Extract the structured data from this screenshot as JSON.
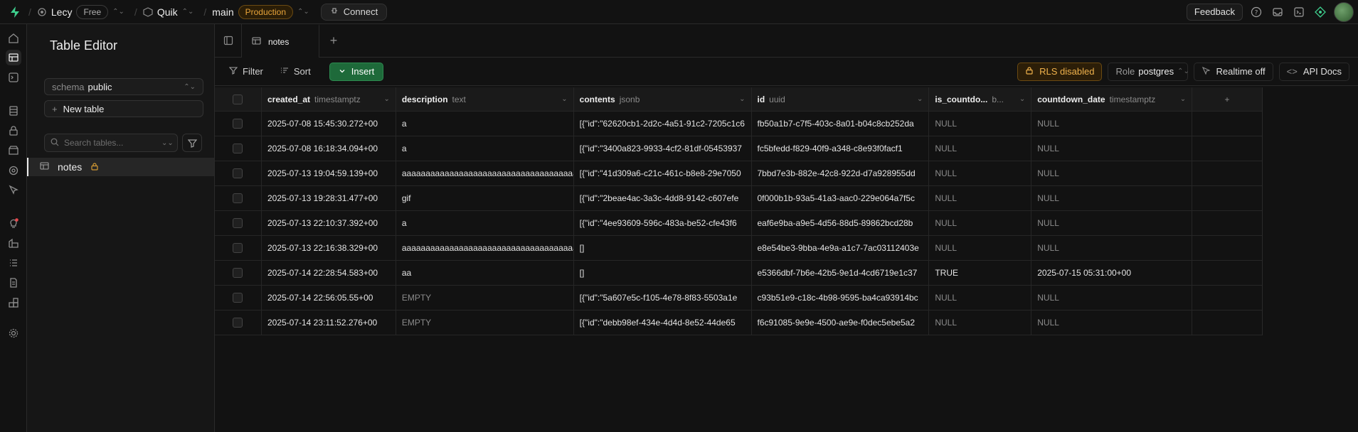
{
  "topbar": {
    "org": "Lecy",
    "plan": "Free",
    "project": "Quik",
    "branch": "main",
    "env": "Production",
    "connect": "Connect",
    "feedback": "Feedback"
  },
  "sidebar": {
    "title": "Table Editor",
    "schema_label": "schema",
    "schema_value": "public",
    "new_table": "New table",
    "search_placeholder": "Search tables...",
    "tables": [
      {
        "name": "notes"
      }
    ]
  },
  "tabs": [
    {
      "label": "notes"
    }
  ],
  "toolbar": {
    "filter": "Filter",
    "sort": "Sort",
    "insert": "Insert",
    "rls": "RLS disabled",
    "role_label": "Role",
    "role_value": "postgres",
    "realtime": "Realtime off",
    "api_docs": "API Docs"
  },
  "columns": [
    {
      "name": "created_at",
      "type": "timestamptz"
    },
    {
      "name": "description",
      "type": "text"
    },
    {
      "name": "contents",
      "type": "jsonb"
    },
    {
      "name": "id",
      "type": "uuid"
    },
    {
      "name": "is_countdo...",
      "type": "b..."
    },
    {
      "name": "countdown_date",
      "type": "timestamptz"
    }
  ],
  "rows": [
    [
      "2025-07-08 15:45:30.272+00",
      "a",
      "[{\"id\":\"62620cb1-2d2c-4a51-91c2-7205c1c6",
      "fb50a1b7-c7f5-403c-8a01-b04c8cb252da",
      "NULL",
      "NULL"
    ],
    [
      "2025-07-08 16:18:34.094+00",
      "a",
      "[{\"id\":\"3400a823-9933-4cf2-81df-05453937",
      "fc5bfedd-f829-40f9-a348-c8e93f0facf1",
      "NULL",
      "NULL"
    ],
    [
      "2025-07-13 19:04:59.139+00",
      "aaaaaaaaaaaaaaaaaaaaaaaaaaaaaaaaaaaaaaaa",
      "[{\"id\":\"41d309a6-c21c-461c-b8e8-29e7050",
      "7bbd7e3b-882e-42c8-922d-d7a928955dd",
      "NULL",
      "NULL"
    ],
    [
      "2025-07-13 19:28:31.477+00",
      "gif",
      "[{\"id\":\"2beae4ac-3a3c-4dd8-9142-c607efe",
      "0f000b1b-93a5-41a3-aac0-229e064a7f5c",
      "NULL",
      "NULL"
    ],
    [
      "2025-07-13 22:10:37.392+00",
      "a",
      "[{\"id\":\"4ee93609-596c-483a-be52-cfe43f6",
      "eaf6e9ba-a9e5-4d56-88d5-89862bcd28b",
      "NULL",
      "NULL"
    ],
    [
      "2025-07-13 22:16:38.329+00",
      "aaaaaaaaaaaaaaaaaaaaaaaaaaaaaaaaaaaaaaaa",
      "[]",
      "e8e54be3-9bba-4e9a-a1c7-7ac03112403e",
      "NULL",
      "NULL"
    ],
    [
      "2025-07-14 22:28:54.583+00",
      "aa",
      "[]",
      "e5366dbf-7b6e-42b5-9e1d-4cd6719e1c37",
      "TRUE",
      "2025-07-15 05:31:00+00"
    ],
    [
      "2025-07-14 22:56:05.55+00",
      "EMPTY",
      "[{\"id\":\"5a607e5c-f105-4e78-8f83-5503a1e",
      "c93b51e9-c18c-4b98-9595-ba4ca93914bc",
      "NULL",
      "NULL"
    ],
    [
      "2025-07-14 23:11:52.276+00",
      "EMPTY",
      "[{\"id\":\"debb98ef-434e-4d4d-8e52-44de65",
      "f6c91085-9e9e-4500-ae9e-f0dec5ebe5a2",
      "NULL",
      "NULL"
    ]
  ],
  "colors": {
    "accent": "#3ecf8e",
    "insert": "#1e6a3a",
    "warning": "#e8a43a"
  }
}
